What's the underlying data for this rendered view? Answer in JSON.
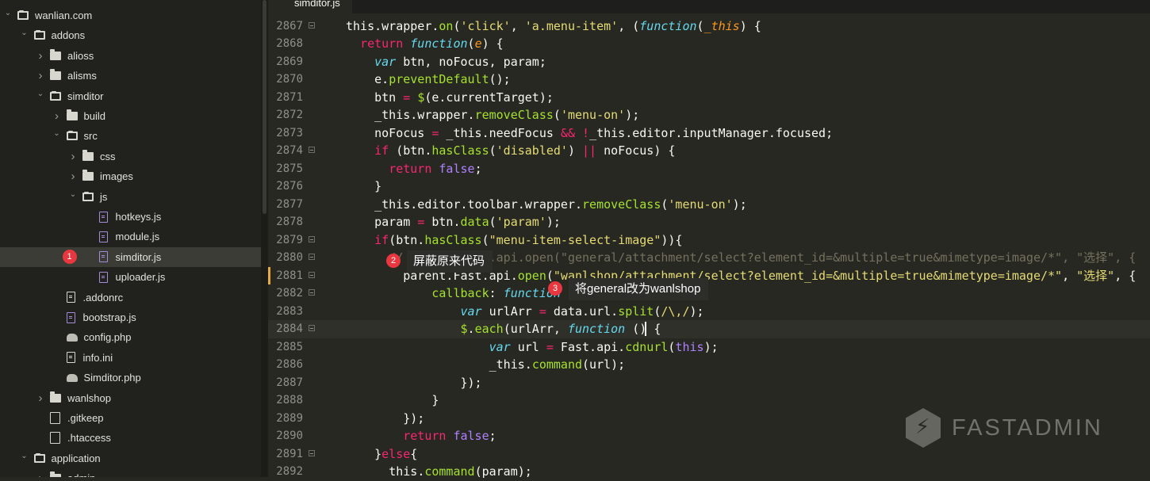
{
  "tab": {
    "label": "simditor.js"
  },
  "tree": [
    {
      "label": "wanlian.com",
      "kind": "folder-open",
      "indent": 0,
      "chev": "open"
    },
    {
      "label": "addons",
      "kind": "folder-open",
      "indent": 1,
      "chev": "open"
    },
    {
      "label": "alioss",
      "kind": "folder",
      "indent": 2,
      "chev": "closed"
    },
    {
      "label": "alisms",
      "kind": "folder",
      "indent": 2,
      "chev": "closed"
    },
    {
      "label": "simditor",
      "kind": "folder-open",
      "indent": 2,
      "chev": "open"
    },
    {
      "label": "build",
      "kind": "folder",
      "indent": 3,
      "chev": "closed"
    },
    {
      "label": "src",
      "kind": "folder-open",
      "indent": 3,
      "chev": "open"
    },
    {
      "label": "css",
      "kind": "folder",
      "indent": 4,
      "chev": "closed"
    },
    {
      "label": "images",
      "kind": "folder",
      "indent": 4,
      "chev": "closed"
    },
    {
      "label": "js",
      "kind": "folder-open",
      "indent": 4,
      "chev": "open"
    },
    {
      "label": "hotkeys.js",
      "kind": "js",
      "indent": 5
    },
    {
      "label": "module.js",
      "kind": "js",
      "indent": 5
    },
    {
      "label": "simditor.js",
      "kind": "js",
      "indent": 5,
      "selected": true,
      "badge": "1"
    },
    {
      "label": "uploader.js",
      "kind": "js",
      "indent": 5
    },
    {
      "label": ".addonrc",
      "kind": "plain",
      "indent": 3
    },
    {
      "label": "bootstrap.js",
      "kind": "js",
      "indent": 3
    },
    {
      "label": "config.php",
      "kind": "php",
      "indent": 3
    },
    {
      "label": "info.ini",
      "kind": "plain",
      "indent": 3
    },
    {
      "label": "Simditor.php",
      "kind": "php",
      "indent": 3
    },
    {
      "label": "wanlshop",
      "kind": "folder",
      "indent": 2,
      "chev": "closed"
    },
    {
      "label": ".gitkeep",
      "kind": "blank",
      "indent": 2
    },
    {
      "label": ".htaccess",
      "kind": "blank",
      "indent": 2
    },
    {
      "label": "application",
      "kind": "folder-open",
      "indent": 1,
      "chev": "open"
    },
    {
      "label": "admin",
      "kind": "folder",
      "indent": 2,
      "chev": "closed"
    }
  ],
  "lines": [
    {
      "n": "2867",
      "fold": true,
      "html": "<span>this</span>.wrapper.<span class=\"f\">on</span>(<span class=\"s\">'click'</span>, <span class=\"s\">'a.menu-item'</span>, (<span class=\"st\">function</span>(<span class=\"p\">_this</span>) {"
    },
    {
      "n": "2868",
      "fold": false,
      "html": "  <span class=\"k\">return</span> <span class=\"st\">function</span>(<span class=\"p\">e</span>) {"
    },
    {
      "n": "2869",
      "fold": false,
      "html": "    <span class=\"st\">var</span> btn, noFocus, param;"
    },
    {
      "n": "2870",
      "fold": false,
      "html": "    e.<span class=\"f\">preventDefault</span>();"
    },
    {
      "n": "2871",
      "fold": false,
      "html": "    btn <span class=\"k\">=</span> <span class=\"f\">$</span>(e.currentTarget);"
    },
    {
      "n": "2872",
      "fold": false,
      "html": "    _this.wrapper.<span class=\"f\">removeClass</span>(<span class=\"s\">'menu-on'</span>);"
    },
    {
      "n": "2873",
      "fold": false,
      "html": "    noFocus <span class=\"k\">=</span> _this.needFocus <span class=\"k\">&amp;&amp;</span> <span class=\"k\">!</span>_this.editor.inputManager.focused;"
    },
    {
      "n": "2874",
      "fold": true,
      "html": "    <span class=\"k\">if</span> (btn.<span class=\"f\">hasClass</span>(<span class=\"s\">'disabled'</span>) <span class=\"k\">||</span> noFocus) {"
    },
    {
      "n": "2875",
      "fold": false,
      "html": "      <span class=\"k\">return</span> <span class=\"c\">false</span>;"
    },
    {
      "n": "2876",
      "fold": false,
      "html": "    }"
    },
    {
      "n": "2877",
      "fold": false,
      "html": "    _this.editor.toolbar.wrapper.<span class=\"f\">removeClass</span>(<span class=\"s\">'menu-on'</span>);"
    },
    {
      "n": "2878",
      "fold": false,
      "html": "    param <span class=\"k\">=</span> btn.<span class=\"f\">data</span>(<span class=\"s\">'param'</span>);"
    },
    {
      "n": "2879",
      "fold": true,
      "html": "    <span class=\"k\">if</span>(btn.<span class=\"f\">hasClass</span>(<span class=\"s\">\"menu-item-select-image\"</span>)){"
    },
    {
      "n": "2880",
      "fold": true,
      "html": "<span class=\"cm\">      // parent.Fast.api.open(\"general/attachment/select?element_id=&amp;multiple=true&amp;mimetype=image/*\", \"选择\", {</span>"
    },
    {
      "n": "2881",
      "fold": true,
      "html": "        parent.Fast.api.<span class=\"f\">open</span>(<span class=\"s\">\"wanlshop/attachment/select?element_id=&amp;multiple=true&amp;mimetype=image/*\"</span>, <span class=\"s\">\"选择\"</span>, {"
    },
    {
      "n": "2882",
      "fold": true,
      "html": "            <span class=\"f\">callback</span>: <span class=\"st\">function</span> (<span class=\"p\">data</span>) {"
    },
    {
      "n": "2883",
      "fold": false,
      "html": "                <span class=\"st\">var</span> urlArr <span class=\"k\">=</span> data.url.<span class=\"f\">split</span>(<span class=\"s\">/\\,/</span>);"
    },
    {
      "n": "2884",
      "fold": true,
      "html": "                <span class=\"f\">$</span>.<span class=\"f\">each</span>(urlArr, <span class=\"st\">function</span> () {"
    },
    {
      "n": "2885",
      "fold": false,
      "html": "                    <span class=\"st\">var</span> url <span class=\"k\">=</span> Fast.api.<span class=\"f\">cdnurl</span>(<span class=\"c\">this</span>);"
    },
    {
      "n": "2886",
      "fold": false,
      "html": "                    _this.<span class=\"f\">command</span>(url);"
    },
    {
      "n": "2887",
      "fold": false,
      "html": "                });"
    },
    {
      "n": "2888",
      "fold": false,
      "html": "            }"
    },
    {
      "n": "2889",
      "fold": false,
      "html": "        });"
    },
    {
      "n": "2890",
      "fold": false,
      "html": "        <span class=\"k\">return</span> <span class=\"c\">false</span>;"
    },
    {
      "n": "2891",
      "fold": true,
      "html": "    }<span class=\"k\">else</span>{"
    },
    {
      "n": "2892",
      "fold": false,
      "html": "      <span>this</span>.<span class=\"f\">command</span>(param);"
    }
  ],
  "annotations": {
    "badge2": "2",
    "badge2_text": "屏蔽原来代码",
    "badge3": "3",
    "badge3_text": "将general改为wanlshop"
  },
  "watermark": "FASTADMIN",
  "colors": {
    "background": "#272822",
    "sidebar": "#21221d",
    "keyword": "#f92672",
    "string": "#e6db74",
    "function": "#a6e22e",
    "storage": "#66d9ef",
    "param": "#fd971f",
    "constant": "#ae81ff",
    "comment": "#75715e",
    "badge": "#e8373f"
  }
}
